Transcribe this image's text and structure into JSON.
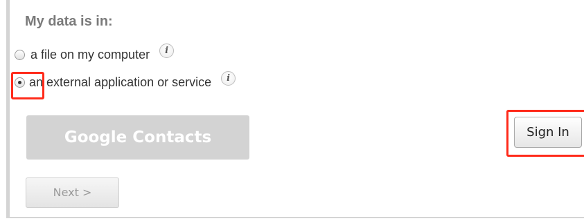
{
  "import_source": {
    "heading": "My data is in:",
    "options": [
      {
        "label": "a file on my computer",
        "selected": false,
        "info_icon": "info-icon"
      },
      {
        "label": "an external application or service",
        "selected": true,
        "info_icon": "info-icon"
      }
    ]
  },
  "buttons": {
    "google_contacts": "Google Contacts",
    "sign_in": "Sign In",
    "next": "Next >"
  },
  "colors": {
    "highlight": "#ff2a1a",
    "disabled_button": "#d3d3d3",
    "heading_text": "#7a7a7a"
  }
}
